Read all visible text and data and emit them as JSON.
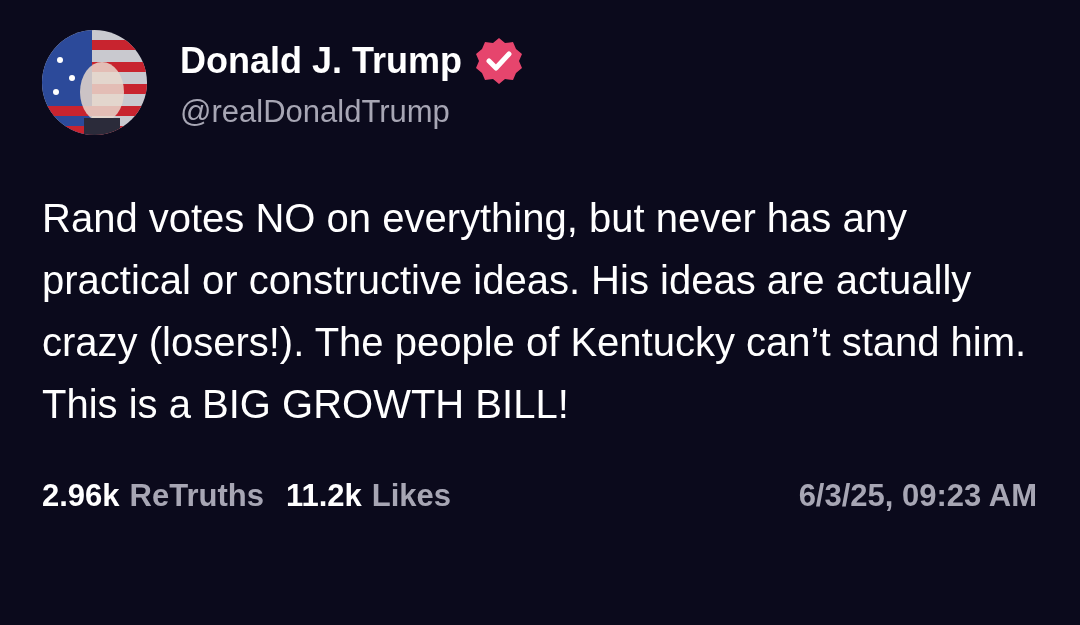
{
  "post": {
    "author": {
      "name": "Donald J. Trump",
      "handle": "@realDonaldTrump",
      "verified": true
    },
    "text": "Rand votes NO on everything, but never has any practical or constructive ideas. His ideas are actually crazy (losers!). The people of Kentucky can’t stand him. This is a BIG GROWTH BILL!",
    "stats": [
      {
        "count": "2.96k",
        "label": "ReTruths"
      },
      {
        "count": "11.2k",
        "label": "Likes"
      }
    ],
    "timestamp": "6/3/25, 09:23 AM"
  }
}
